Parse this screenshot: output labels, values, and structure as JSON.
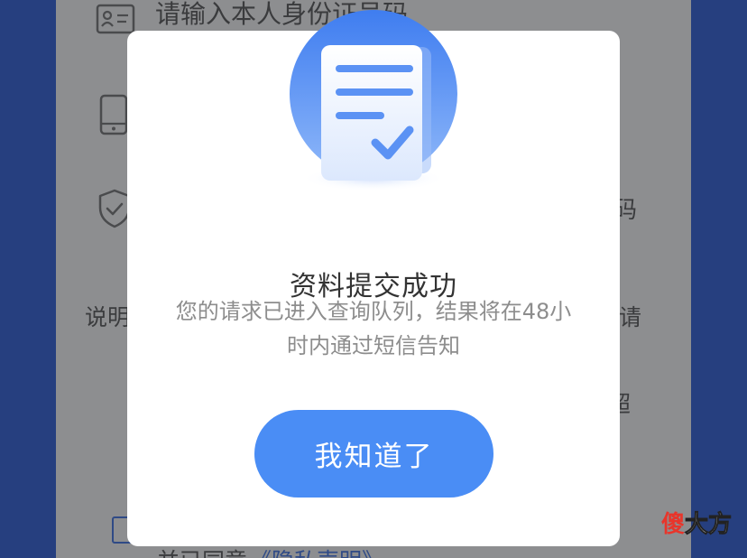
{
  "background_form": {
    "id_placeholder": "请输入本人身份证号码",
    "code_suffix": "码",
    "note_label": "说明",
    "note_suffix": "请",
    "partial_char": "超",
    "agree_text": "并已同意",
    "privacy_link": "《隐私声明》"
  },
  "dialog": {
    "title": "资料提交成功",
    "message_line1": "您的请求已进入查询队列，结果将在48小",
    "message_line2": "时内通过短信告知",
    "ok_button_label": "我知道了"
  },
  "watermark": {
    "part1": "傻",
    "part2": "大方"
  },
  "colors": {
    "accent": "#4a8df5",
    "overlay_page": "#8d8e90",
    "side_background": "#263f7f",
    "title_text": "#333333",
    "message_text": "#8d8d8d"
  },
  "icons": [
    "id-card-icon",
    "phone-icon",
    "shield-check-icon",
    "document-check-icon",
    "checkbox-icon"
  ]
}
